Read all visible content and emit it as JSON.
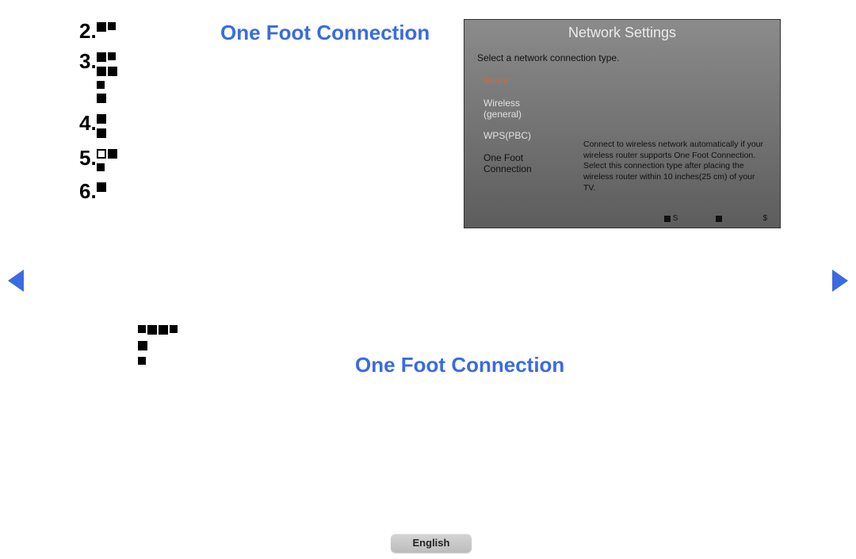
{
  "headings": {
    "top": "One Foot Connection",
    "mid": "One Foot Connection"
  },
  "list": {
    "n2": "2.",
    "n3": "3.",
    "n4": "4.",
    "n5": "5.",
    "n6": "6."
  },
  "panel": {
    "title": "Network Settings",
    "subtitle": "Select a network connection type.",
    "items": {
      "wired": "Wired",
      "wireless_l1": "Wireless",
      "wireless_l2": "(general)",
      "wps": "WPS(PBC)",
      "onefoot_l1": "One Foot",
      "onefoot_l2": "Connection"
    },
    "desc": "Connect to wireless network automatically if your wireless router supports One Foot Connection. Select this connection type after placing the wireless router within 10 inches(25 cm) of your TV.",
    "footer": {
      "a": "S",
      "b": "",
      "c": "$"
    }
  },
  "language": "English"
}
